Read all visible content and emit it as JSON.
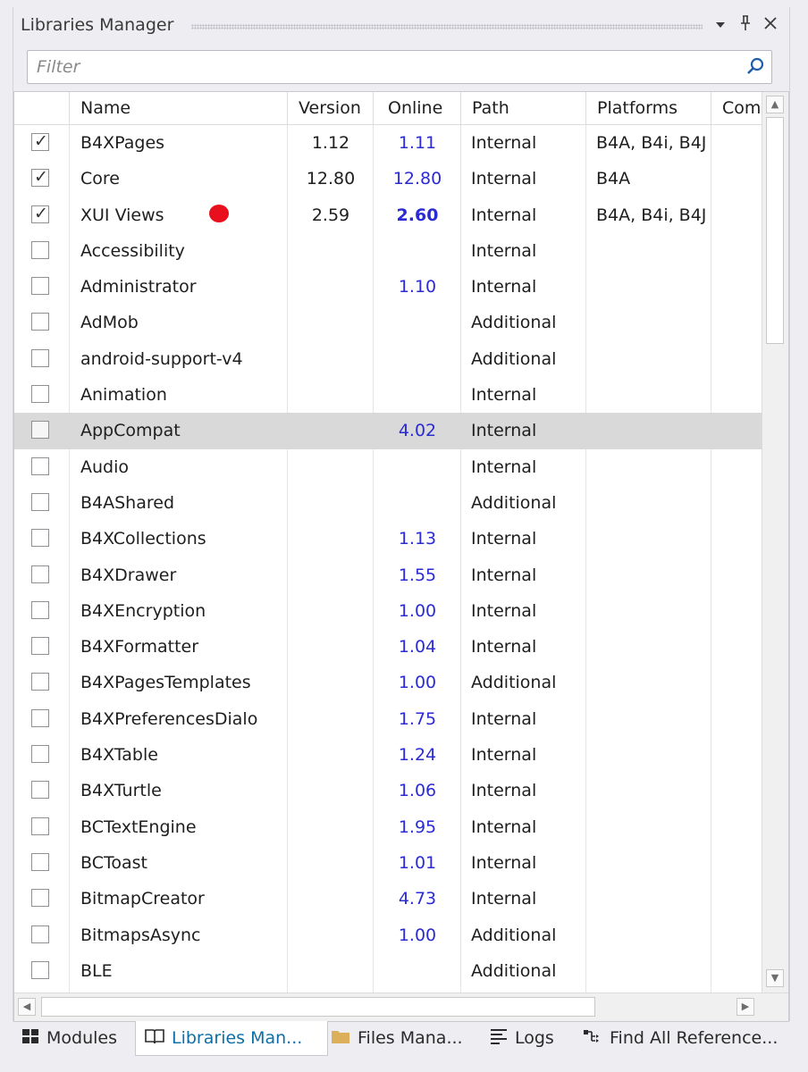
{
  "panel": {
    "title": "Libraries Manager",
    "dropdown_glyph": "▾",
    "pin_glyph": "📌",
    "close_glyph": "✕"
  },
  "filter": {
    "placeholder": "Filter",
    "value": "",
    "icon": "search-icon"
  },
  "columns": [
    "",
    "Name",
    "Version",
    "Online",
    "Path",
    "Platforms",
    "Com"
  ],
  "rows": [
    {
      "checked": true,
      "name": "B4XPages",
      "version": "1.12",
      "online": "1.11",
      "path": "Internal",
      "platforms": "B4A, B4i, B4J"
    },
    {
      "checked": true,
      "name": "Core",
      "version": "12.80",
      "online": "12.80",
      "path": "Internal",
      "platforms": "B4A"
    },
    {
      "checked": true,
      "name": "XUI Views",
      "version": "2.59",
      "online": "2.60",
      "online_bold": true,
      "path": "Internal",
      "platforms": "B4A, B4i, B4J"
    },
    {
      "checked": false,
      "name": "Accessibility",
      "version": "",
      "online": "",
      "path": "Internal",
      "platforms": ""
    },
    {
      "checked": false,
      "name": "Administrator",
      "version": "",
      "online": "1.10",
      "path": "Internal",
      "platforms": ""
    },
    {
      "checked": false,
      "name": "AdMob",
      "version": "",
      "online": "",
      "path": "Additional",
      "platforms": ""
    },
    {
      "checked": false,
      "name": "android-support-v4",
      "version": "",
      "online": "",
      "path": "Additional",
      "platforms": ""
    },
    {
      "checked": false,
      "name": "Animation",
      "version": "",
      "online": "",
      "path": "Internal",
      "platforms": ""
    },
    {
      "checked": false,
      "name": "AppCompat",
      "version": "",
      "online": "4.02",
      "path": "Internal",
      "platforms": "",
      "selected": true
    },
    {
      "checked": false,
      "name": "Audio",
      "version": "",
      "online": "",
      "path": "Internal",
      "platforms": ""
    },
    {
      "checked": false,
      "name": "B4AShared",
      "version": "",
      "online": "",
      "path": "Additional",
      "platforms": ""
    },
    {
      "checked": false,
      "name": "B4XCollections",
      "version": "",
      "online": "1.13",
      "path": "Internal",
      "platforms": ""
    },
    {
      "checked": false,
      "name": "B4XDrawer",
      "version": "",
      "online": "1.55",
      "path": "Internal",
      "platforms": ""
    },
    {
      "checked": false,
      "name": "B4XEncryption",
      "version": "",
      "online": "1.00",
      "path": "Internal",
      "platforms": ""
    },
    {
      "checked": false,
      "name": "B4XFormatter",
      "version": "",
      "online": "1.04",
      "path": "Internal",
      "platforms": ""
    },
    {
      "checked": false,
      "name": "B4XPagesTemplates",
      "version": "",
      "online": "1.00",
      "path": "Additional",
      "platforms": ""
    },
    {
      "checked": false,
      "name": "B4XPreferencesDialo",
      "version": "",
      "online": "1.75",
      "path": "Internal",
      "platforms": ""
    },
    {
      "checked": false,
      "name": "B4XTable",
      "version": "",
      "online": "1.24",
      "path": "Internal",
      "platforms": ""
    },
    {
      "checked": false,
      "name": "B4XTurtle",
      "version": "",
      "online": "1.06",
      "path": "Internal",
      "platforms": ""
    },
    {
      "checked": false,
      "name": "BCTextEngine",
      "version": "",
      "online": "1.95",
      "path": "Internal",
      "platforms": ""
    },
    {
      "checked": false,
      "name": "BCToast",
      "version": "",
      "online": "1.01",
      "path": "Internal",
      "platforms": ""
    },
    {
      "checked": false,
      "name": "BitmapCreator",
      "version": "",
      "online": "4.73",
      "path": "Internal",
      "platforms": ""
    },
    {
      "checked": false,
      "name": "BitmapsAsync",
      "version": "",
      "online": "1.00",
      "path": "Additional",
      "platforms": ""
    },
    {
      "checked": false,
      "name": "BLE",
      "version": "",
      "online": "",
      "path": "Additional",
      "platforms": ""
    }
  ],
  "tabs": [
    {
      "label": "Modules",
      "icon": "modules-icon",
      "active": false
    },
    {
      "label": "Libraries Man...",
      "icon": "book-icon",
      "active": true
    },
    {
      "label": "Files Mana...",
      "icon": "folder-icon",
      "active": false
    },
    {
      "label": "Logs",
      "icon": "logs-icon",
      "active": false
    },
    {
      "label": "Find All Reference...",
      "icon": "find-references-icon",
      "active": false
    }
  ],
  "colors": {
    "online_text": "#2b2bd3",
    "active_tab_text": "#0e6fa8",
    "marker_dot": "#e8101c",
    "selected_row": "#d9d9d9"
  }
}
